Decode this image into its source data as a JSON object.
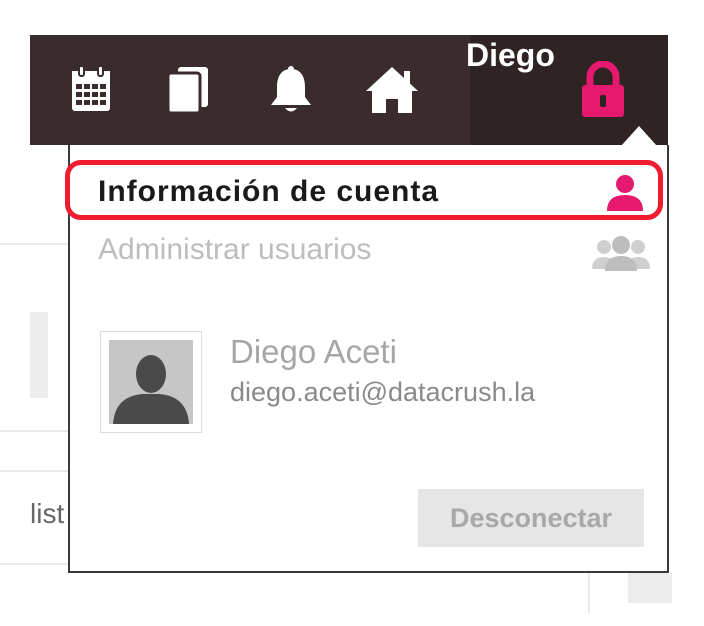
{
  "navbar": {
    "icons": [
      "calendar-icon",
      "copy-icon",
      "bell-icon",
      "home-icon",
      "lock-icon"
    ],
    "username": "Diego",
    "accent_color": "#e5196e",
    "background_color": "#3a2c2c"
  },
  "menu": {
    "items": [
      {
        "label": "Información de cuenta",
        "icon": "user-icon",
        "state": "active"
      },
      {
        "label": "Administrar usuarios",
        "icon": "users-icon",
        "state": "disabled"
      }
    ],
    "highlight_color": "#ee1c2e"
  },
  "profile": {
    "name": "Diego Aceti",
    "email": "diego.aceti@datacrush.la"
  },
  "logout_label": "Desconectar",
  "background_fragment_text": "list"
}
